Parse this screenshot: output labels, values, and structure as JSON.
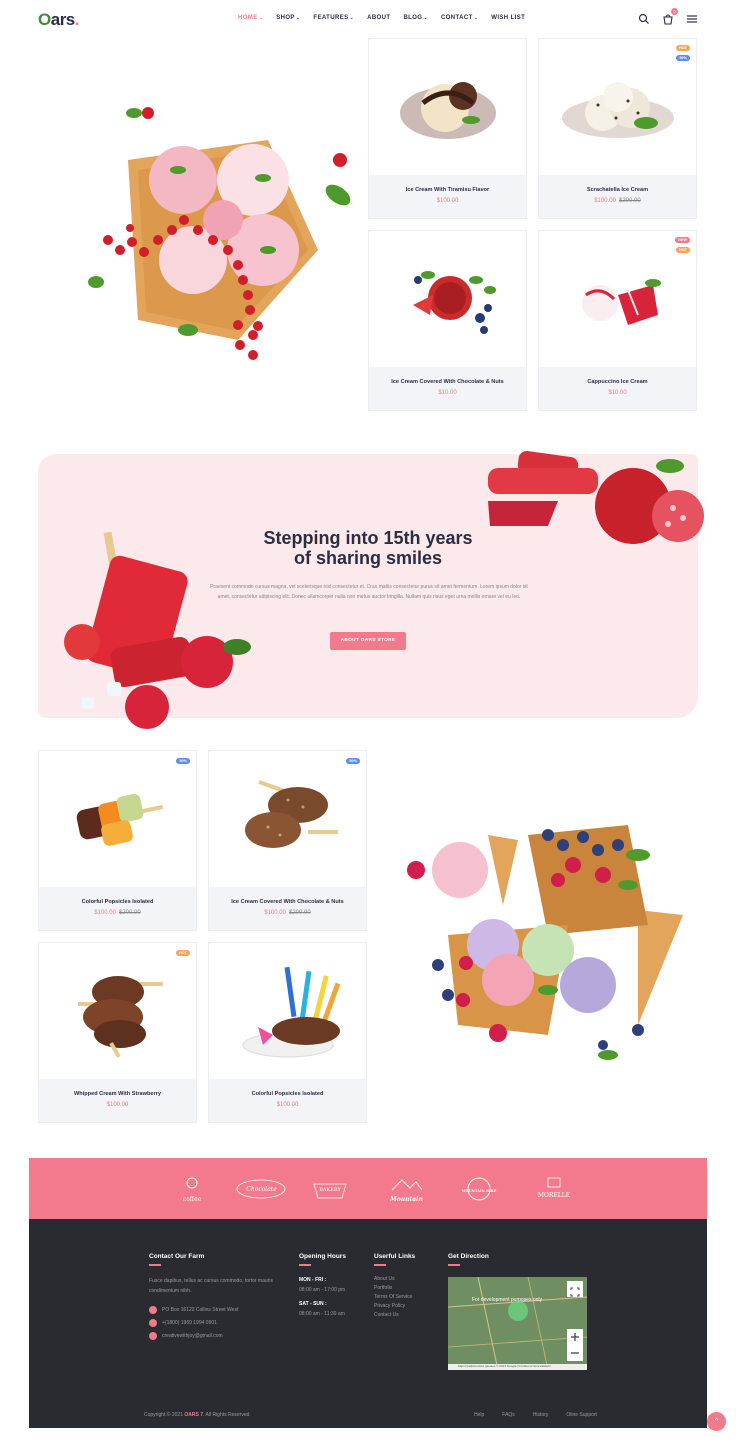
{
  "header": {
    "logo": {
      "o": "O",
      "rest": "ars",
      "dot": "."
    },
    "nav": [
      {
        "label": "HOME",
        "has_dropdown": true,
        "active": true
      },
      {
        "label": "SHOP",
        "has_dropdown": true,
        "active": false
      },
      {
        "label": "FEATURES",
        "has_dropdown": true,
        "active": false
      },
      {
        "label": "ABOUT",
        "has_dropdown": false,
        "active": false
      },
      {
        "label": "BLOG",
        "has_dropdown": true,
        "active": false
      },
      {
        "label": "CONTACT",
        "has_dropdown": true,
        "active": false
      },
      {
        "label": "WISH LIST",
        "has_dropdown": false,
        "active": false
      }
    ],
    "cart_count": "0",
    "icons": [
      "search-icon",
      "cart-icon",
      "menu-icon"
    ]
  },
  "products_top": [
    {
      "name": "Ice Cream With Tiramisu Flavor",
      "price": "$100.00",
      "old_price": "",
      "badges": []
    },
    {
      "name": "Scrachatella Ice Cream",
      "price": "$100.00",
      "old_price": "$200.00",
      "badges": [
        "HOT",
        "50%"
      ]
    },
    {
      "name": "Ice Cream Covered With Chocolate & Nuts",
      "price": "$10.00",
      "old_price": "",
      "badges": []
    },
    {
      "name": "Cappuccino Ice Cream",
      "price": "$10.00",
      "old_price": "",
      "badges": [
        "NEW",
        "HOT"
      ]
    }
  ],
  "story": {
    "title_line1": "Stepping into 15th years",
    "title_line2": "of sharing smiles",
    "text": "Praesent commodo cursus magna, vel scelerisque nisl consectetur et. Cras mattis consectetur purus sit amet fermentum. Lorem ipsum dolor sit amet, consectetur adipiscing elit. Donec ullamcorper nulla non metus auctor fringilla. Nullam quis risus eget urna mollis ornare vel eu leo.",
    "button": "ABOUT OARS STORE"
  },
  "products_bottom": [
    {
      "name": "Colorful Popsicles Isolated",
      "price": "$100.00",
      "old_price": "$200.00",
      "badges": [
        "50%"
      ]
    },
    {
      "name": "Ice Cream Covered With Chocolate & Nuts",
      "price": "$100.00",
      "old_price": "$200.00",
      "badges": [
        "50%"
      ]
    },
    {
      "name": "Whipped Cream With Strawberry",
      "price": "$100.00",
      "old_price": "",
      "badges": [
        "HOT"
      ]
    },
    {
      "name": "Colorful Popsicles Isolated",
      "price": "$100.00",
      "old_price": "",
      "badges": []
    }
  ],
  "brands": [
    "coffee",
    "Chocolate",
    "BAKERY",
    "Mountain",
    "MOUNTAIN BIKE",
    "MORELLE"
  ],
  "footer": {
    "contact_title": "Contact Our Farm",
    "contact_text": "Fusce dapibus, tellus ac cursus commodo, tortor mauris condimentum nibh.",
    "address": "PO Box 16122 Collins Street West",
    "phone": "+(1800) 1969 1994 0901",
    "email": "creativewithjoy@gmail.com",
    "hours_title": "Opening Hours",
    "weekdays_label": "MON - FRI :",
    "weekdays_hours": "08:00 am - 17:00 pm",
    "weekend_label": "SAT - SUN :",
    "weekend_hours": "08:00 am - 11:30 am",
    "links_title": "Userful Links",
    "links": [
      "About Us",
      "Portfolio",
      "Terms Of Service",
      "Privacy Policy",
      "Contact Us"
    ],
    "direction_title": "Get Direction",
    "map_overlay": "For development purposes only",
    "map_attribution": "Картографические данные © 2021 Google   Условия использования",
    "copyright_prefix": "Copyright © 2021 ",
    "copyright_brand": "OARS 7",
    "copyright_suffix": ". All Rights Reserved",
    "bottom_links": [
      "Help",
      "FAQs",
      "History",
      "Oline Support"
    ]
  },
  "colors": {
    "accent": "#f27a8c",
    "dark": "#2b2d42",
    "footer_bg": "#2a2b31",
    "card_info_bg": "#f3f4f8",
    "story_bg": "#fbe9ec"
  }
}
